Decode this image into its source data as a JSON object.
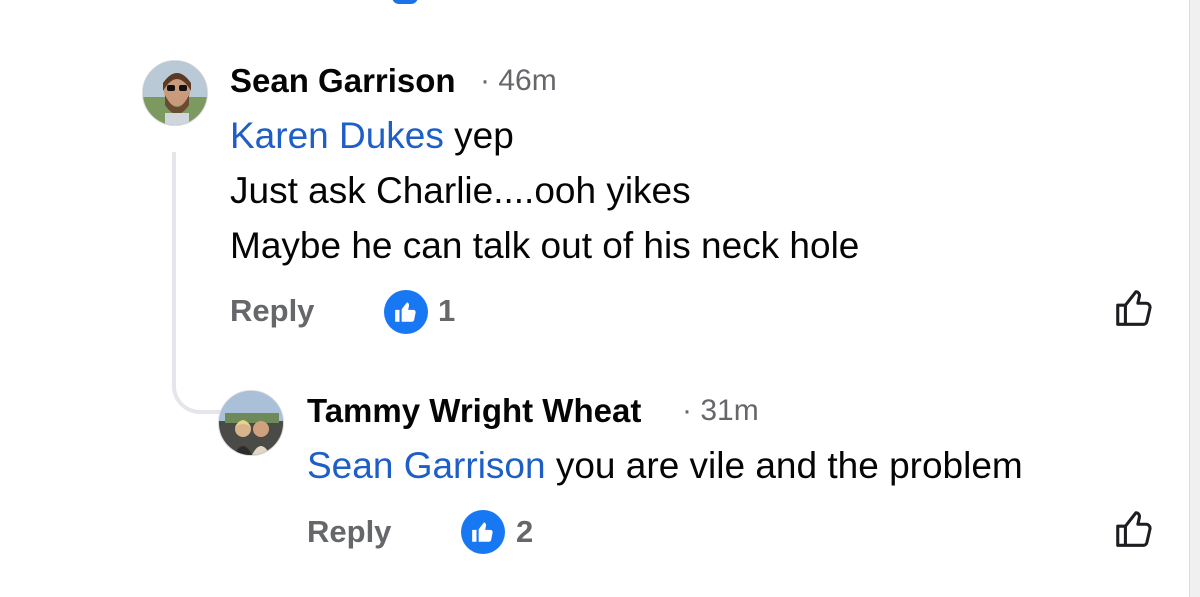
{
  "comments": [
    {
      "author": "Sean Garrison",
      "time": "· 46m",
      "mention": "Karen Dukes",
      "lines": [
        " yep",
        "Just ask Charlie....ooh yikes",
        "Maybe he can talk out of his neck hole"
      ],
      "reply_label": "Reply",
      "like_count": "1"
    },
    {
      "author": "Tammy Wright Wheat",
      "time": "· 31m",
      "mention": "Sean Garrison",
      "lines": [
        " you are vile and the problem"
      ],
      "reply_label": "Reply",
      "like_count": "2"
    }
  ],
  "colors": {
    "mention": "#1e5ec7",
    "reaction_blue": "#1877f2",
    "meta_gray": "#65676b"
  },
  "icons": {
    "reaction": "like-reaction-icon",
    "like_button": "thumbs-up-outline-icon"
  }
}
